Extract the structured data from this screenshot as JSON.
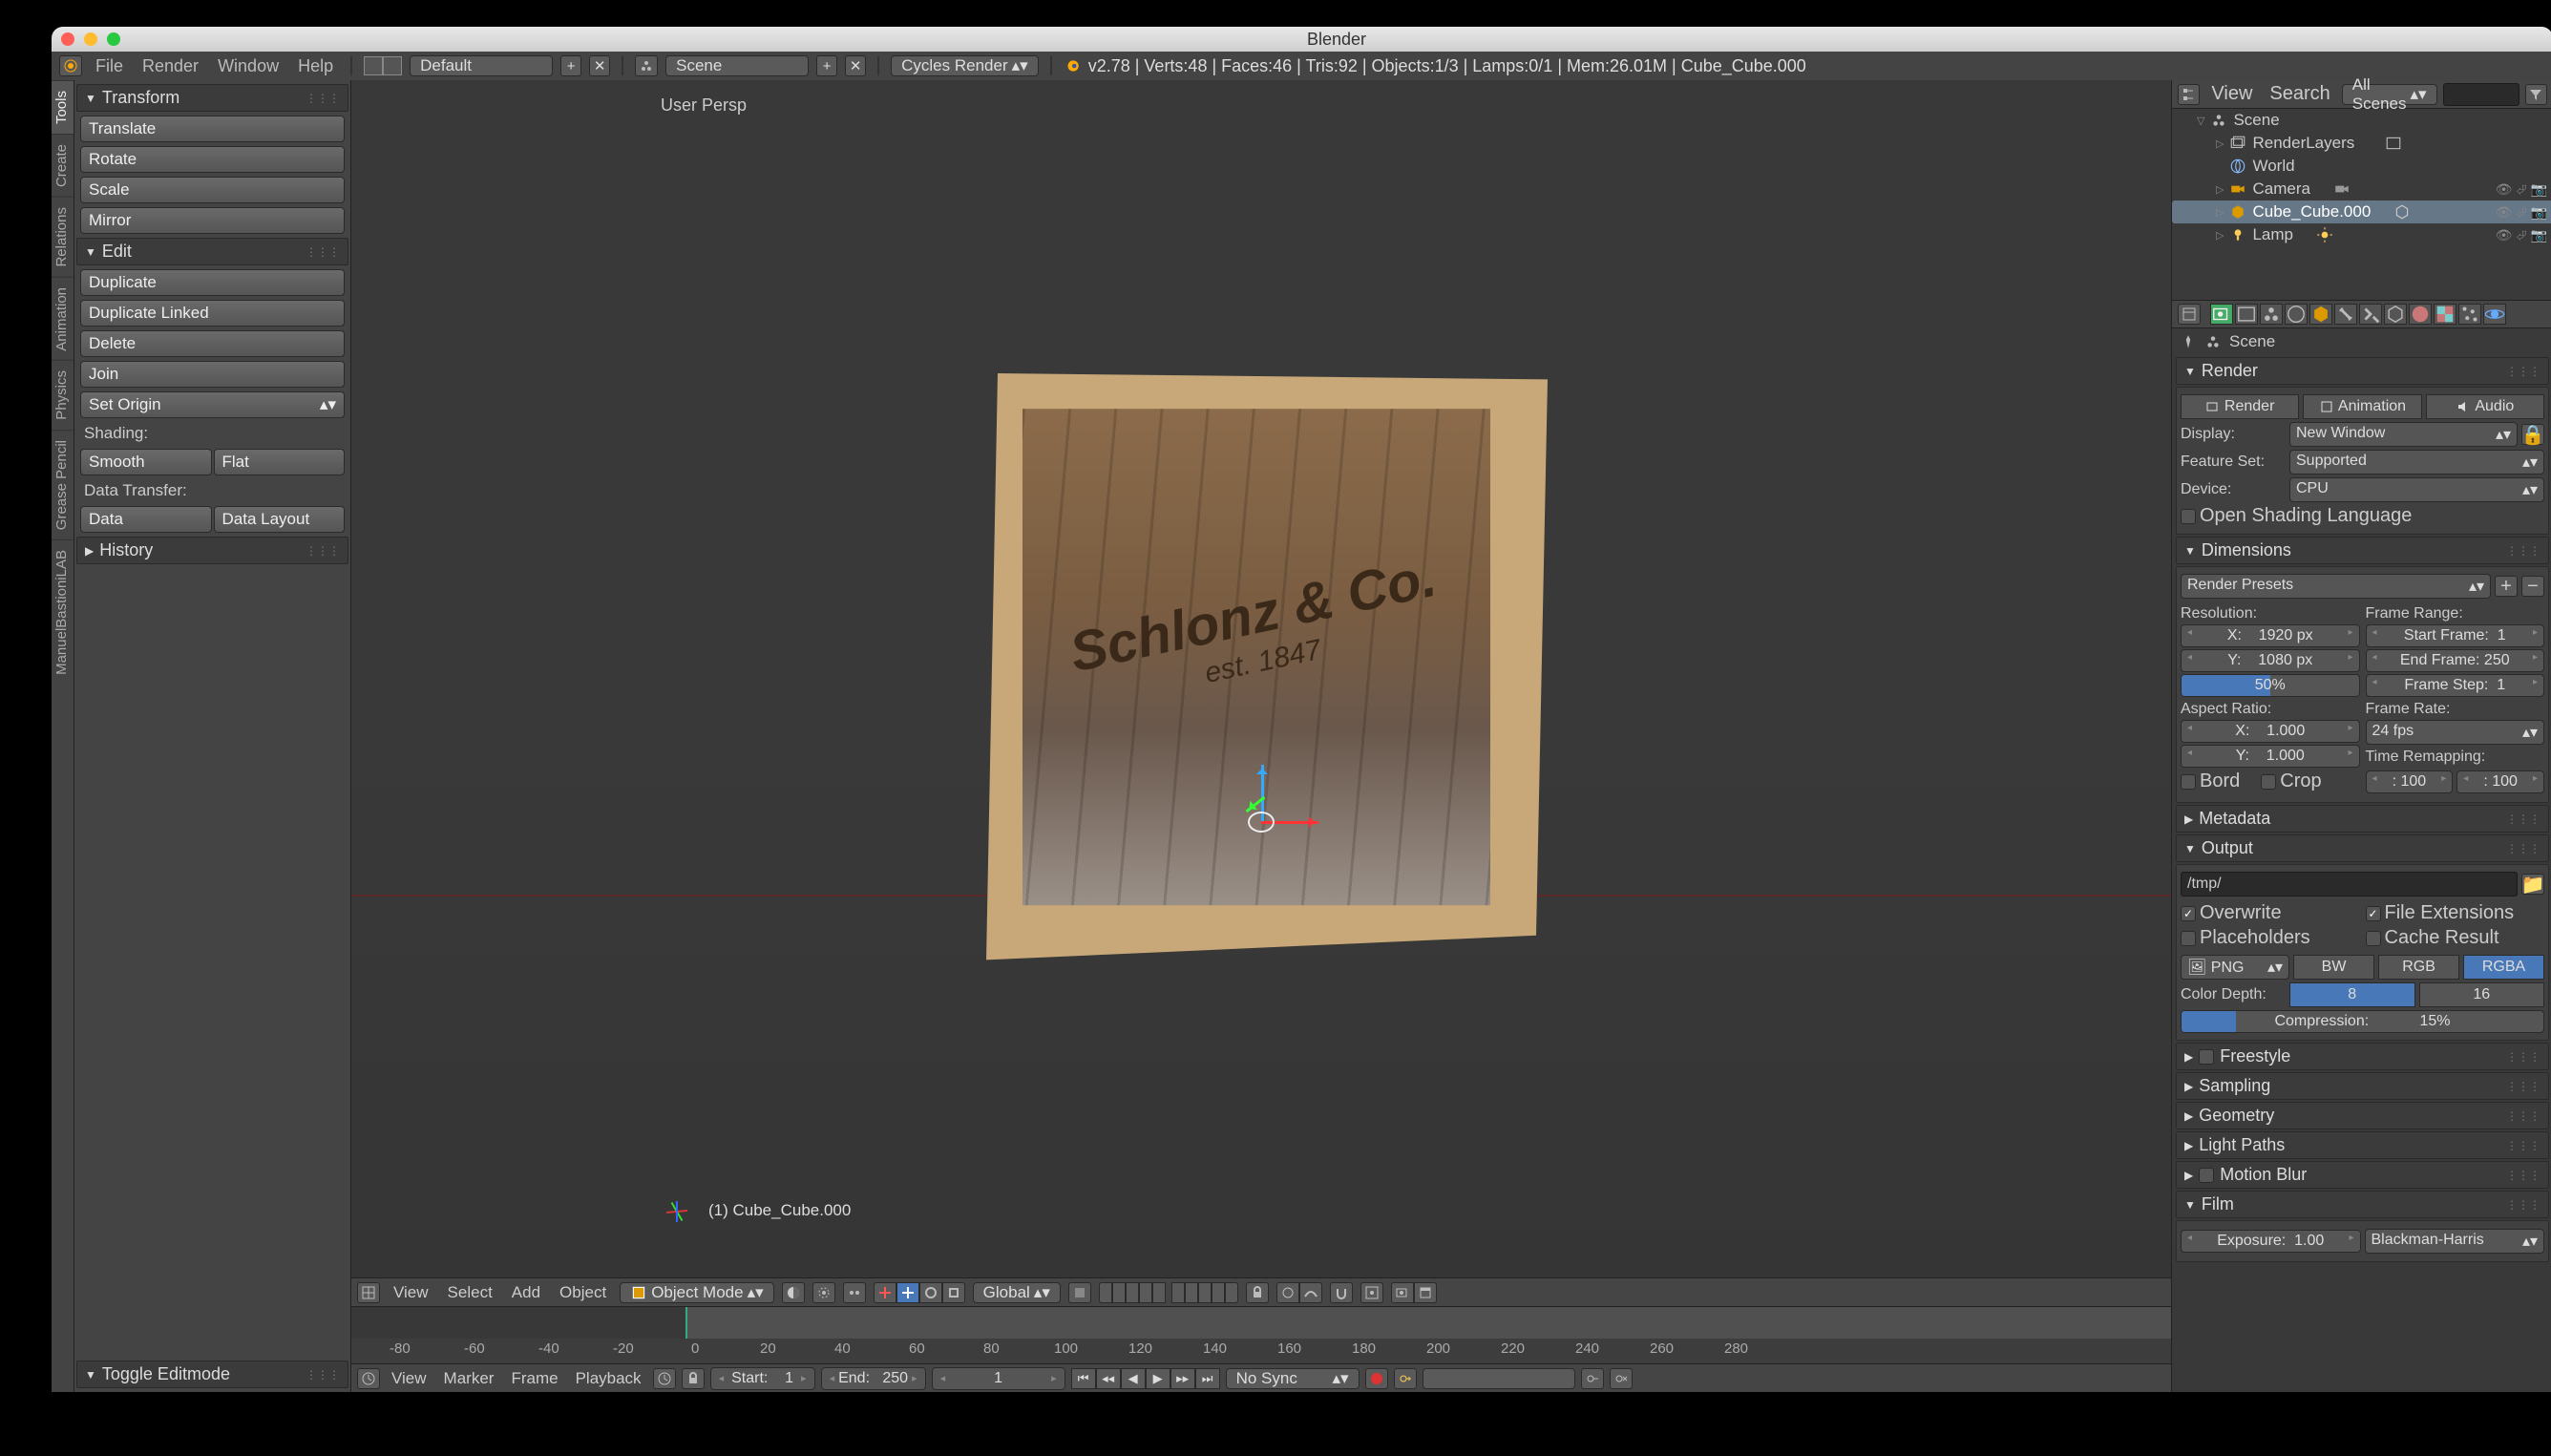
{
  "os_title": "Blender",
  "top": {
    "menus": [
      "File",
      "Render",
      "Window",
      "Help"
    ],
    "layout": "Default",
    "scene": "Scene",
    "engine": "Cycles Render",
    "stats": "v2.78 | Verts:48 | Faces:46 | Tris:92 | Objects:1/3 | Lamps:0/1 | Mem:26.01M | Cube_Cube.000"
  },
  "vtabs": [
    "Tools",
    "Create",
    "Relations",
    "Animation",
    "Physics",
    "Grease Pencil",
    "ManuelBastioniLAB"
  ],
  "toolshelf": {
    "transform_hdr": "Transform",
    "translate": "Translate",
    "rotate": "Rotate",
    "scale": "Scale",
    "mirror": "Mirror",
    "edit_hdr": "Edit",
    "duplicate": "Duplicate",
    "dup_linked": "Duplicate Linked",
    "delete": "Delete",
    "join": "Join",
    "set_origin": "Set Origin",
    "shading_lbl": "Shading:",
    "smooth": "Smooth",
    "flat": "Flat",
    "data_lbl": "Data Transfer:",
    "data": "Data",
    "data_layout": "Data Layout",
    "history_hdr": "History",
    "op_hdr": "Toggle Editmode"
  },
  "viewport": {
    "persp": "User Persp",
    "obj_label": "(1) Cube_Cube.000",
    "crate_line1": "Schlonz & Co.",
    "crate_line2": "est. 1847"
  },
  "vheader": {
    "menus": [
      "View",
      "Select",
      "Add",
      "Object"
    ],
    "mode": "Object Mode",
    "orient": "Global"
  },
  "timeline": {
    "ticks": [
      "-80",
      "-60",
      "-40",
      "-20",
      "0",
      "20",
      "40",
      "60",
      "80",
      "100",
      "120",
      "140",
      "160",
      "180",
      "200",
      "220",
      "240",
      "260",
      "280"
    ]
  },
  "tlheader": {
    "menus": [
      "View",
      "Marker",
      "Frame",
      "Playback"
    ],
    "start_lbl": "Start:",
    "start_val": "1",
    "end_lbl": "End:",
    "end_val": "250",
    "cur_val": "1",
    "sync": "No Sync"
  },
  "outliner": {
    "search_ph": "",
    "menu": [
      "View",
      "Search"
    ],
    "filter": "All Scenes",
    "items": [
      {
        "name": "Scene",
        "kind": "scene"
      },
      {
        "name": "RenderLayers",
        "kind": "renderlayers"
      },
      {
        "name": "World",
        "kind": "world"
      },
      {
        "name": "Camera",
        "kind": "camera"
      },
      {
        "name": "Cube_Cube.000",
        "kind": "mesh",
        "sel": true
      },
      {
        "name": "Lamp",
        "kind": "lamp"
      }
    ]
  },
  "props": {
    "crumb": "Scene",
    "render_hdr": "Render",
    "btn_render": "Render",
    "btn_anim": "Animation",
    "btn_audio": "Audio",
    "display_lbl": "Display:",
    "display_val": "New Window",
    "feature_lbl": "Feature Set:",
    "feature_val": "Supported",
    "device_lbl": "Device:",
    "device_val": "CPU",
    "osl": "Open Shading Language",
    "dim_hdr": "Dimensions",
    "presets": "Render Presets",
    "res_lbl": "Resolution:",
    "frange_lbl": "Frame Range:",
    "res_x": "X:",
    "res_x_val": "1920 px",
    "res_y": "Y:",
    "res_y_val": "1080 px",
    "res_pct": "50%",
    "sf_lbl": "Start Frame:",
    "sf_val": "1",
    "ef_lbl": "End Frame:",
    "ef_val": "250",
    "fs_lbl": "Frame Step:",
    "fs_val": "1",
    "aspect_lbl": "Aspect Ratio:",
    "frate_lbl": "Frame Rate:",
    "ax": "X:",
    "ax_val": "1.000",
    "ay": "Y:",
    "ay_val": "1.000",
    "fps": "24 fps",
    "tremap": "Time Remapping:",
    "bord": "Bord",
    "crop": "Crop",
    "old": ": 100",
    "new": ": 100",
    "meta_hdr": "Metadata",
    "out_hdr": "Output",
    "out_path": "/tmp/",
    "overwrite": "Overwrite",
    "fileext": "File Extensions",
    "placeholders": "Placeholders",
    "cache": "Cache Result",
    "format": "PNG",
    "bw": "BW",
    "rgb": "RGB",
    "rgba": "RGBA",
    "cdepth": "Color Depth:",
    "d8": "8",
    "d16": "16",
    "compr": "Compression:",
    "compr_val": "15%",
    "freestyle": "Freestyle",
    "sampling": "Sampling",
    "geometry": "Geometry",
    "lightpaths": "Light Paths",
    "motionblur": "Motion Blur",
    "film": "Film",
    "exposure_lbl": "Exposure:",
    "exposure_val": "1.00",
    "pixfilter": "Blackman-Harris"
  }
}
